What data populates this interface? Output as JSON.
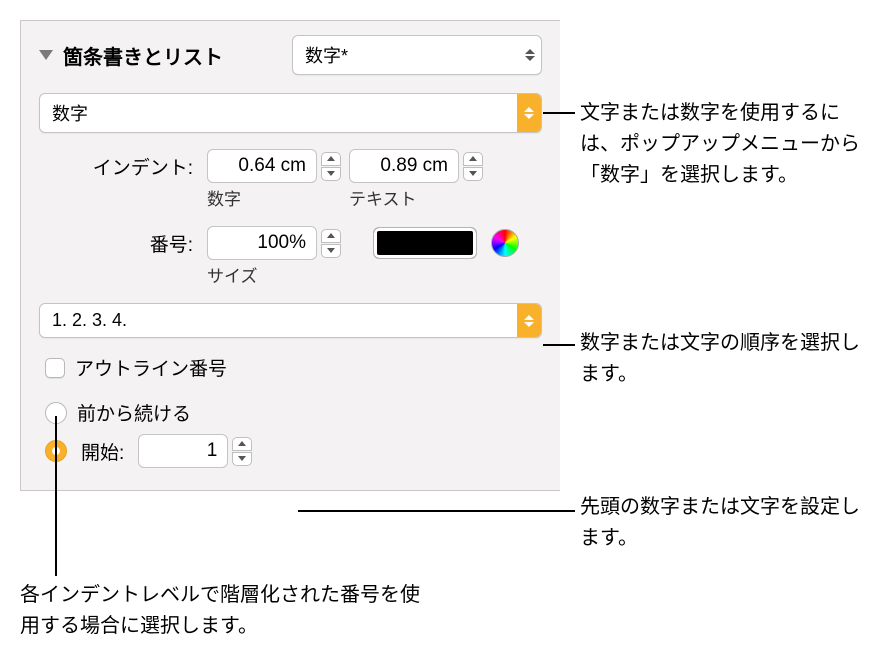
{
  "section_title": "箇条書きとリスト",
  "style_popup": "数字*",
  "type_popup": "数字",
  "indent": {
    "label": "インデント:",
    "number_value": "0.64 cm",
    "text_value": "0.89 cm",
    "sub_number": "数字",
    "sub_text": "テキスト"
  },
  "number_row": {
    "label": "番号:",
    "size_value": "100%",
    "sub_size": "サイズ"
  },
  "sequence_popup": "1. 2. 3. 4.",
  "outline_checkbox": "アウトライン番号",
  "radio_continue": "前から続ける",
  "radio_start": "開始:",
  "start_value": "1",
  "callouts": {
    "c1": "文字または数字を使用するには、ポップアップメニューから「数字」を選択します。",
    "c2": "数字または文字の順序を選択します。",
    "c3": "先頭の数字または文字を設定します。",
    "c4": "各インデントレベルで階層化された番号を使用する場合に選択します。"
  }
}
